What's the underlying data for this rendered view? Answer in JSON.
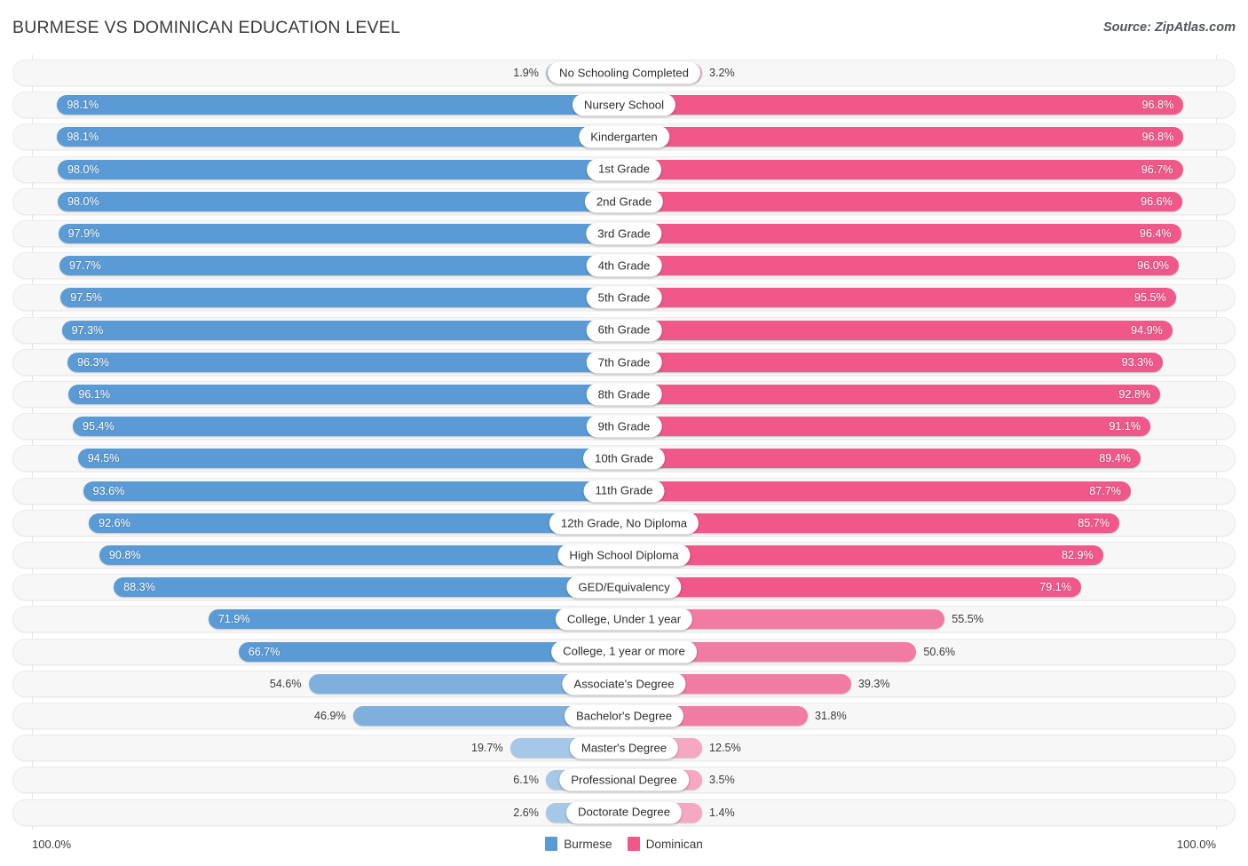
{
  "header": {
    "title": "BURMESE VS DOMINICAN EDUCATION LEVEL",
    "source": "Source: ZipAtlas.com"
  },
  "axis": {
    "left_label": "100.0%",
    "right_label": "100.0%"
  },
  "legend": {
    "items": [
      {
        "label": "Burmese",
        "color": "#5b9bd5"
      },
      {
        "label": "Dominican",
        "color": "#f0588a"
      }
    ]
  },
  "colors": {
    "burmese_strong": "#5b9bd5",
    "burmese_mid": "#7fb0dd",
    "burmese_light": "#a6c8e8",
    "dominican_strong": "#f0588a",
    "dominican_mid": "#f27ba4",
    "dominican_light": "#f6a8c3",
    "track_bg": "#f7f7f7",
    "track_border": "#ebebeb",
    "gridline": "#e6e6e6",
    "text": "#3b3b3b"
  },
  "chart_data": {
    "type": "bar",
    "orientation": "horizontal-diverging",
    "title": "BURMESE VS DOMINICAN EDUCATION LEVEL",
    "xlabel": "",
    "ylabel": "",
    "xlim": [
      0,
      100
    ],
    "grid": false,
    "legend_position": "bottom-center",
    "unit": "%",
    "categories": [
      "No Schooling Completed",
      "Nursery School",
      "Kindergarten",
      "1st Grade",
      "2nd Grade",
      "3rd Grade",
      "4th Grade",
      "5th Grade",
      "6th Grade",
      "7th Grade",
      "8th Grade",
      "9th Grade",
      "10th Grade",
      "11th Grade",
      "12th Grade, No Diploma",
      "High School Diploma",
      "GED/Equivalency",
      "College, Under 1 year",
      "College, 1 year or more",
      "Associate's Degree",
      "Bachelor's Degree",
      "Master's Degree",
      "Professional Degree",
      "Doctorate Degree"
    ],
    "series": [
      {
        "name": "Burmese",
        "color": "#5b9bd5",
        "values": [
          1.9,
          98.1,
          98.1,
          98.0,
          98.0,
          97.9,
          97.7,
          97.5,
          97.3,
          96.3,
          96.1,
          95.4,
          94.5,
          93.6,
          92.6,
          90.8,
          88.3,
          71.9,
          66.7,
          54.6,
          46.9,
          19.7,
          6.1,
          2.6
        ]
      },
      {
        "name": "Dominican",
        "color": "#f0588a",
        "values": [
          3.2,
          96.8,
          96.8,
          96.7,
          96.6,
          96.4,
          96.0,
          95.5,
          94.9,
          93.3,
          92.8,
          91.1,
          89.4,
          87.7,
          85.7,
          82.9,
          79.1,
          55.5,
          50.6,
          39.3,
          31.8,
          12.5,
          3.5,
          1.4
        ]
      }
    ],
    "rows": [
      {
        "category": "No Schooling Completed",
        "left_value": 1.9,
        "left_label": "1.9%",
        "right_value": 3.2,
        "right_label": "3.2%",
        "left_inside": false,
        "right_inside": false
      },
      {
        "category": "Nursery School",
        "left_value": 98.1,
        "left_label": "98.1%",
        "right_value": 96.8,
        "right_label": "96.8%",
        "left_inside": true,
        "right_inside": true
      },
      {
        "category": "Kindergarten",
        "left_value": 98.1,
        "left_label": "98.1%",
        "right_value": 96.8,
        "right_label": "96.8%",
        "left_inside": true,
        "right_inside": true
      },
      {
        "category": "1st Grade",
        "left_value": 98.0,
        "left_label": "98.0%",
        "right_value": 96.7,
        "right_label": "96.7%",
        "left_inside": true,
        "right_inside": true
      },
      {
        "category": "2nd Grade",
        "left_value": 98.0,
        "left_label": "98.0%",
        "right_value": 96.6,
        "right_label": "96.6%",
        "left_inside": true,
        "right_inside": true
      },
      {
        "category": "3rd Grade",
        "left_value": 97.9,
        "left_label": "97.9%",
        "right_value": 96.4,
        "right_label": "96.4%",
        "left_inside": true,
        "right_inside": true
      },
      {
        "category": "4th Grade",
        "left_value": 97.7,
        "left_label": "97.7%",
        "right_value": 96.0,
        "right_label": "96.0%",
        "left_inside": true,
        "right_inside": true
      },
      {
        "category": "5th Grade",
        "left_value": 97.5,
        "left_label": "97.5%",
        "right_value": 95.5,
        "right_label": "95.5%",
        "left_inside": true,
        "right_inside": true
      },
      {
        "category": "6th Grade",
        "left_value": 97.3,
        "left_label": "97.3%",
        "right_value": 94.9,
        "right_label": "94.9%",
        "left_inside": true,
        "right_inside": true
      },
      {
        "category": "7th Grade",
        "left_value": 96.3,
        "left_label": "96.3%",
        "right_value": 93.3,
        "right_label": "93.3%",
        "left_inside": true,
        "right_inside": true
      },
      {
        "category": "8th Grade",
        "left_value": 96.1,
        "left_label": "96.1%",
        "right_value": 92.8,
        "right_label": "92.8%",
        "left_inside": true,
        "right_inside": true
      },
      {
        "category": "9th Grade",
        "left_value": 95.4,
        "left_label": "95.4%",
        "right_value": 91.1,
        "right_label": "91.1%",
        "left_inside": true,
        "right_inside": true
      },
      {
        "category": "10th Grade",
        "left_value": 94.5,
        "left_label": "94.5%",
        "right_value": 89.4,
        "right_label": "89.4%",
        "left_inside": true,
        "right_inside": true
      },
      {
        "category": "11th Grade",
        "left_value": 93.6,
        "left_label": "93.6%",
        "right_value": 87.7,
        "right_label": "87.7%",
        "left_inside": true,
        "right_inside": true
      },
      {
        "category": "12th Grade, No Diploma",
        "left_value": 92.6,
        "left_label": "92.6%",
        "right_value": 85.7,
        "right_label": "85.7%",
        "left_inside": true,
        "right_inside": true
      },
      {
        "category": "High School Diploma",
        "left_value": 90.8,
        "left_label": "90.8%",
        "right_value": 82.9,
        "right_label": "82.9%",
        "left_inside": true,
        "right_inside": true
      },
      {
        "category": "GED/Equivalency",
        "left_value": 88.3,
        "left_label": "88.3%",
        "right_value": 79.1,
        "right_label": "79.1%",
        "left_inside": true,
        "right_inside": true
      },
      {
        "category": "College, Under 1 year",
        "left_value": 71.9,
        "left_label": "71.9%",
        "right_value": 55.5,
        "right_label": "55.5%",
        "left_inside": true,
        "right_inside": false
      },
      {
        "category": "College, 1 year or more",
        "left_value": 66.7,
        "left_label": "66.7%",
        "right_value": 50.6,
        "right_label": "50.6%",
        "left_inside": true,
        "right_inside": false
      },
      {
        "category": "Associate's Degree",
        "left_value": 54.6,
        "left_label": "54.6%",
        "right_value": 39.3,
        "right_label": "39.3%",
        "left_inside": false,
        "right_inside": false
      },
      {
        "category": "Bachelor's Degree",
        "left_value": 46.9,
        "left_label": "46.9%",
        "right_value": 31.8,
        "right_label": "31.8%",
        "left_inside": false,
        "right_inside": false
      },
      {
        "category": "Master's Degree",
        "left_value": 19.7,
        "left_label": "19.7%",
        "right_value": 12.5,
        "right_label": "12.5%",
        "left_inside": false,
        "right_inside": false
      },
      {
        "category": "Professional Degree",
        "left_value": 6.1,
        "left_label": "6.1%",
        "right_value": 3.5,
        "right_label": "3.5%",
        "left_inside": false,
        "right_inside": false
      },
      {
        "category": "Doctorate Degree",
        "left_value": 2.6,
        "left_label": "2.6%",
        "right_value": 1.4,
        "right_label": "1.4%",
        "left_inside": false,
        "right_inside": false
      }
    ]
  }
}
